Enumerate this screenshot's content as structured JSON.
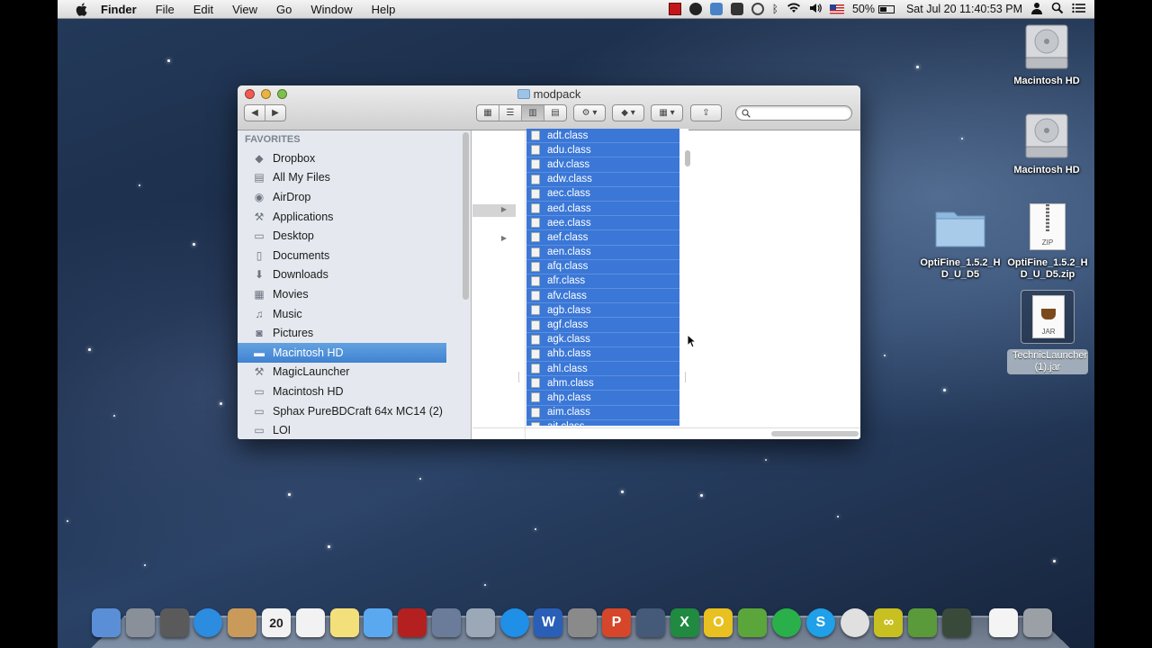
{
  "menubar": {
    "app": "Finder",
    "items": [
      "File",
      "Edit",
      "View",
      "Go",
      "Window",
      "Help"
    ],
    "battery": "50%",
    "datetime": "Sat Jul 20  11:40:53 PM"
  },
  "window": {
    "title": "modpack",
    "sidebar": {
      "heading": "FAVORITES",
      "items": [
        {
          "label": "Dropbox",
          "icon": "dropbox-icon"
        },
        {
          "label": "All My Files",
          "icon": "all-files-icon"
        },
        {
          "label": "AirDrop",
          "icon": "airdrop-icon"
        },
        {
          "label": "Applications",
          "icon": "applications-icon"
        },
        {
          "label": "Desktop",
          "icon": "desktop-icon"
        },
        {
          "label": "Documents",
          "icon": "documents-icon"
        },
        {
          "label": "Downloads",
          "icon": "downloads-icon"
        },
        {
          "label": "Movies",
          "icon": "movies-icon"
        },
        {
          "label": "Music",
          "icon": "music-icon"
        },
        {
          "label": "Pictures",
          "icon": "pictures-icon"
        },
        {
          "label": "Macintosh HD",
          "icon": "drive-icon"
        },
        {
          "label": "MagicLauncher",
          "icon": "applications-icon"
        },
        {
          "label": "Macintosh HD",
          "icon": "folder-icon"
        },
        {
          "label": "Sphax PureBDCraft  64x MC14 (2)",
          "icon": "folder-icon"
        },
        {
          "label": "LOI",
          "icon": "folder-icon"
        }
      ],
      "selected_index": 10
    },
    "files": [
      "adt.class",
      "adu.class",
      "adv.class",
      "adw.class",
      "aec.class",
      "aed.class",
      "aee.class",
      "aef.class",
      "aen.class",
      "afq.class",
      "afr.class",
      "afv.class",
      "agb.class",
      "agf.class",
      "agk.class",
      "ahb.class",
      "ahl.class",
      "ahm.class",
      "ahp.class",
      "aim.class",
      "ait.class"
    ]
  },
  "desktop": {
    "icons": [
      {
        "label": "Macintosh HD",
        "icon": "hard-drive-icon"
      },
      {
        "label": "Macintosh HD",
        "icon": "hard-drive-icon"
      },
      {
        "label": "OptiFine_1.5.2_HD_U_D5",
        "icon": "folder-icon"
      },
      {
        "label": "OptiFine_1.5.2_HD_U_D5.zip",
        "icon": "zip-file-icon",
        "badge": "ZIP"
      },
      {
        "label": "TechnicLauncher (1).jar",
        "icon": "jar-file-icon",
        "badge": "JAR"
      }
    ]
  },
  "dock": {
    "apps": [
      "finder-icon",
      "launchpad-icon",
      "mission-control-icon",
      "safari-icon",
      "contacts-icon",
      "calendar-icon",
      "reminders-icon",
      "notes-icon",
      "messages-icon",
      "photo-booth-icon",
      "iphoto-icon",
      "mail-stamp-icon",
      "itunes-icon",
      "word-icon",
      "system-preferences-icon",
      "powerpoint-icon",
      "facetime-icon",
      "excel-icon",
      "outlook-icon",
      "evernote-icon",
      "spotify-icon",
      "skype-icon",
      "chrome-icon",
      "infinity-icon",
      "minecraft-icon",
      "terminal-icon",
      "document-icon",
      "trash-icon"
    ],
    "calendar_day": "20"
  },
  "colors": {
    "selection": "#3b77d6",
    "sidebar_selection": "#4a8ad6"
  }
}
